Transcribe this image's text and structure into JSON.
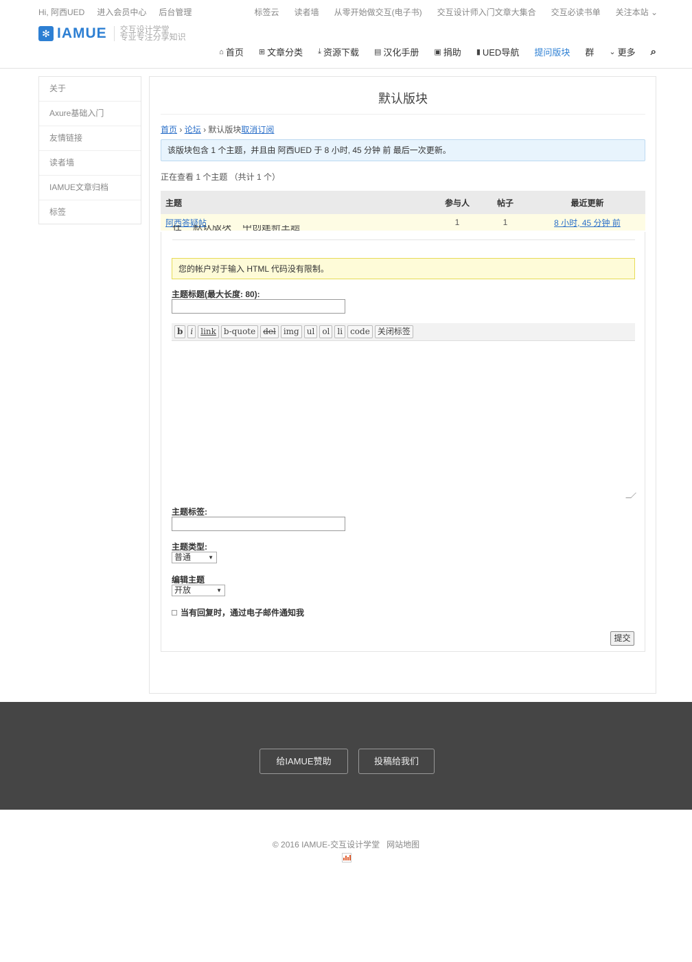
{
  "topbar": {
    "left": [
      "Hi, 阿西UED",
      "进入会员中心",
      "后台管理"
    ],
    "right": [
      "标签云",
      "读者墙",
      "从零开始做交互(电子书)",
      "交互设计师入门文章大集合",
      "交互必读书单",
      "关注本站 ⌄"
    ]
  },
  "logo": {
    "name": "IAMUE",
    "slogan_line1": "交互设计学堂",
    "slogan_line2": "专业专注分享知识"
  },
  "nav": [
    {
      "icon": "home-icon",
      "glyph": "⌂",
      "label": "首页"
    },
    {
      "icon": "sitemap-icon",
      "glyph": "⊞",
      "label": "文章分类"
    },
    {
      "icon": "download-icon",
      "glyph": "⤓",
      "label": "资源下载"
    },
    {
      "icon": "file-icon",
      "glyph": "▤",
      "label": "汉化手册"
    },
    {
      "icon": "money-icon",
      "glyph": "▣",
      "label": "捐助"
    },
    {
      "icon": "bookmark-icon",
      "glyph": "▮",
      "label": "UED导航"
    },
    {
      "icon": "",
      "glyph": "",
      "label": "提问版块"
    },
    {
      "icon": "",
      "glyph": "",
      "label": "群"
    },
    {
      "icon": "chevron-circle-icon",
      "glyph": "⌄",
      "label": "更多"
    }
  ],
  "search_glyph": "⌕",
  "sidebar": [
    "关于",
    "Axure基础入门",
    "友情链接",
    "读者墙",
    "IAMUE文章归档",
    "标签"
  ],
  "page": {
    "title": "默认版块",
    "breadcrumb": {
      "home": "首页",
      "sep1": "›",
      "forum": "论坛",
      "sep2": "›",
      "current": "默认版块",
      "unsubscribe": "取消订阅"
    },
    "notice": "该版块包含 1 个主题，并且由  阿西UED 于 8 小时, 45 分钟 前 最后一次更新。",
    "viewing": "正在查看 1 个主题 （共计 1 个）",
    "table": {
      "headers": {
        "topic": "主题",
        "voices": "参与人",
        "posts": "帖子",
        "freshness": "最近更新"
      },
      "rows": [
        {
          "topic": "阿西答疑帖",
          "voices": "1",
          "posts": "1",
          "freshness": "8 小时, 45 分钟 前"
        }
      ]
    }
  },
  "form": {
    "legend_prefix": "在",
    "legend_forum": "默认版块",
    "legend_suffix": "中创建新主题",
    "html_notice": "您的帐户对于输入 HTML 代码没有限制。",
    "title_label": "主题标题(最大长度: 80):",
    "title_value": "",
    "toolbar": [
      "b",
      "i",
      "link",
      "b-quote",
      "del",
      "img",
      "ul",
      "ol",
      "li",
      "code",
      "关闭标签"
    ],
    "tags_label": "主题标签:",
    "tags_value": "",
    "type_label": "主题类型:",
    "type_value": "普通",
    "status_label": "编辑主题",
    "status_value": "开放",
    "notify_label": "当有回复时，通过电子邮件通知我",
    "submit": "提交"
  },
  "footer": {
    "sponsor": "给IAMUE赞助",
    "contribute": "投稿给我们",
    "copyright": "© 2016 IAMUE-交互设计学堂",
    "sitemap": "网站地图"
  }
}
